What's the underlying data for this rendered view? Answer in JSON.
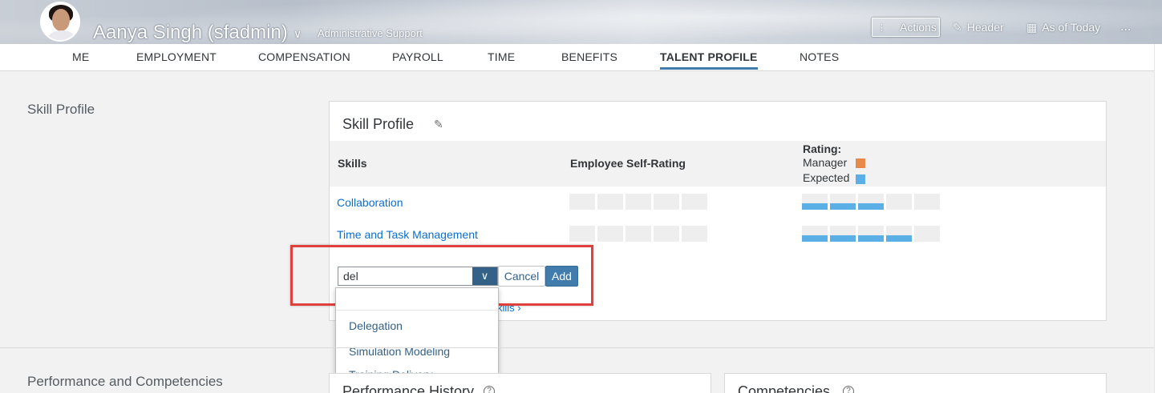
{
  "header": {
    "name": "Aanya Singh (sfadmin)",
    "role": "Administrative Support",
    "actions_label": "Actions",
    "header_label": "Header",
    "as_of_label": "As of Today",
    "more_label": "..."
  },
  "tabs": [
    "ME",
    "EMPLOYMENT",
    "COMPENSATION",
    "PAYROLL",
    "TIME",
    "BENEFITS",
    "TALENT PROFILE",
    "NOTES"
  ],
  "active_tab": "TALENT PROFILE",
  "skill_section": {
    "section_title": "Skill Profile",
    "card_title": "Skill Profile",
    "col_skills": "Skills",
    "col_self_rating": "Employee Self-Rating",
    "rating_label": "Rating:",
    "legend_manager": "Manager",
    "legend_expected": "Expected",
    "colors": {
      "manager": "#e8894a",
      "expected": "#5ab0e6"
    },
    "rows": [
      {
        "skill": "Collaboration",
        "self_rating": 0,
        "expected": 3,
        "scale": 5
      },
      {
        "skill": "Time and Task Management",
        "self_rating": 0,
        "expected": 4,
        "scale": 5
      }
    ],
    "combo_value": "del",
    "cancel_label": "Cancel",
    "add_label": "Add",
    "more_link_tail": "kills",
    "dropdown_options": [
      "Delegation",
      "Simulation Modeling",
      "Training Delivery"
    ]
  },
  "performance_section": {
    "section_title": "Performance and Competencies",
    "history_title": "Performance History",
    "competencies_title": "Competencies"
  }
}
